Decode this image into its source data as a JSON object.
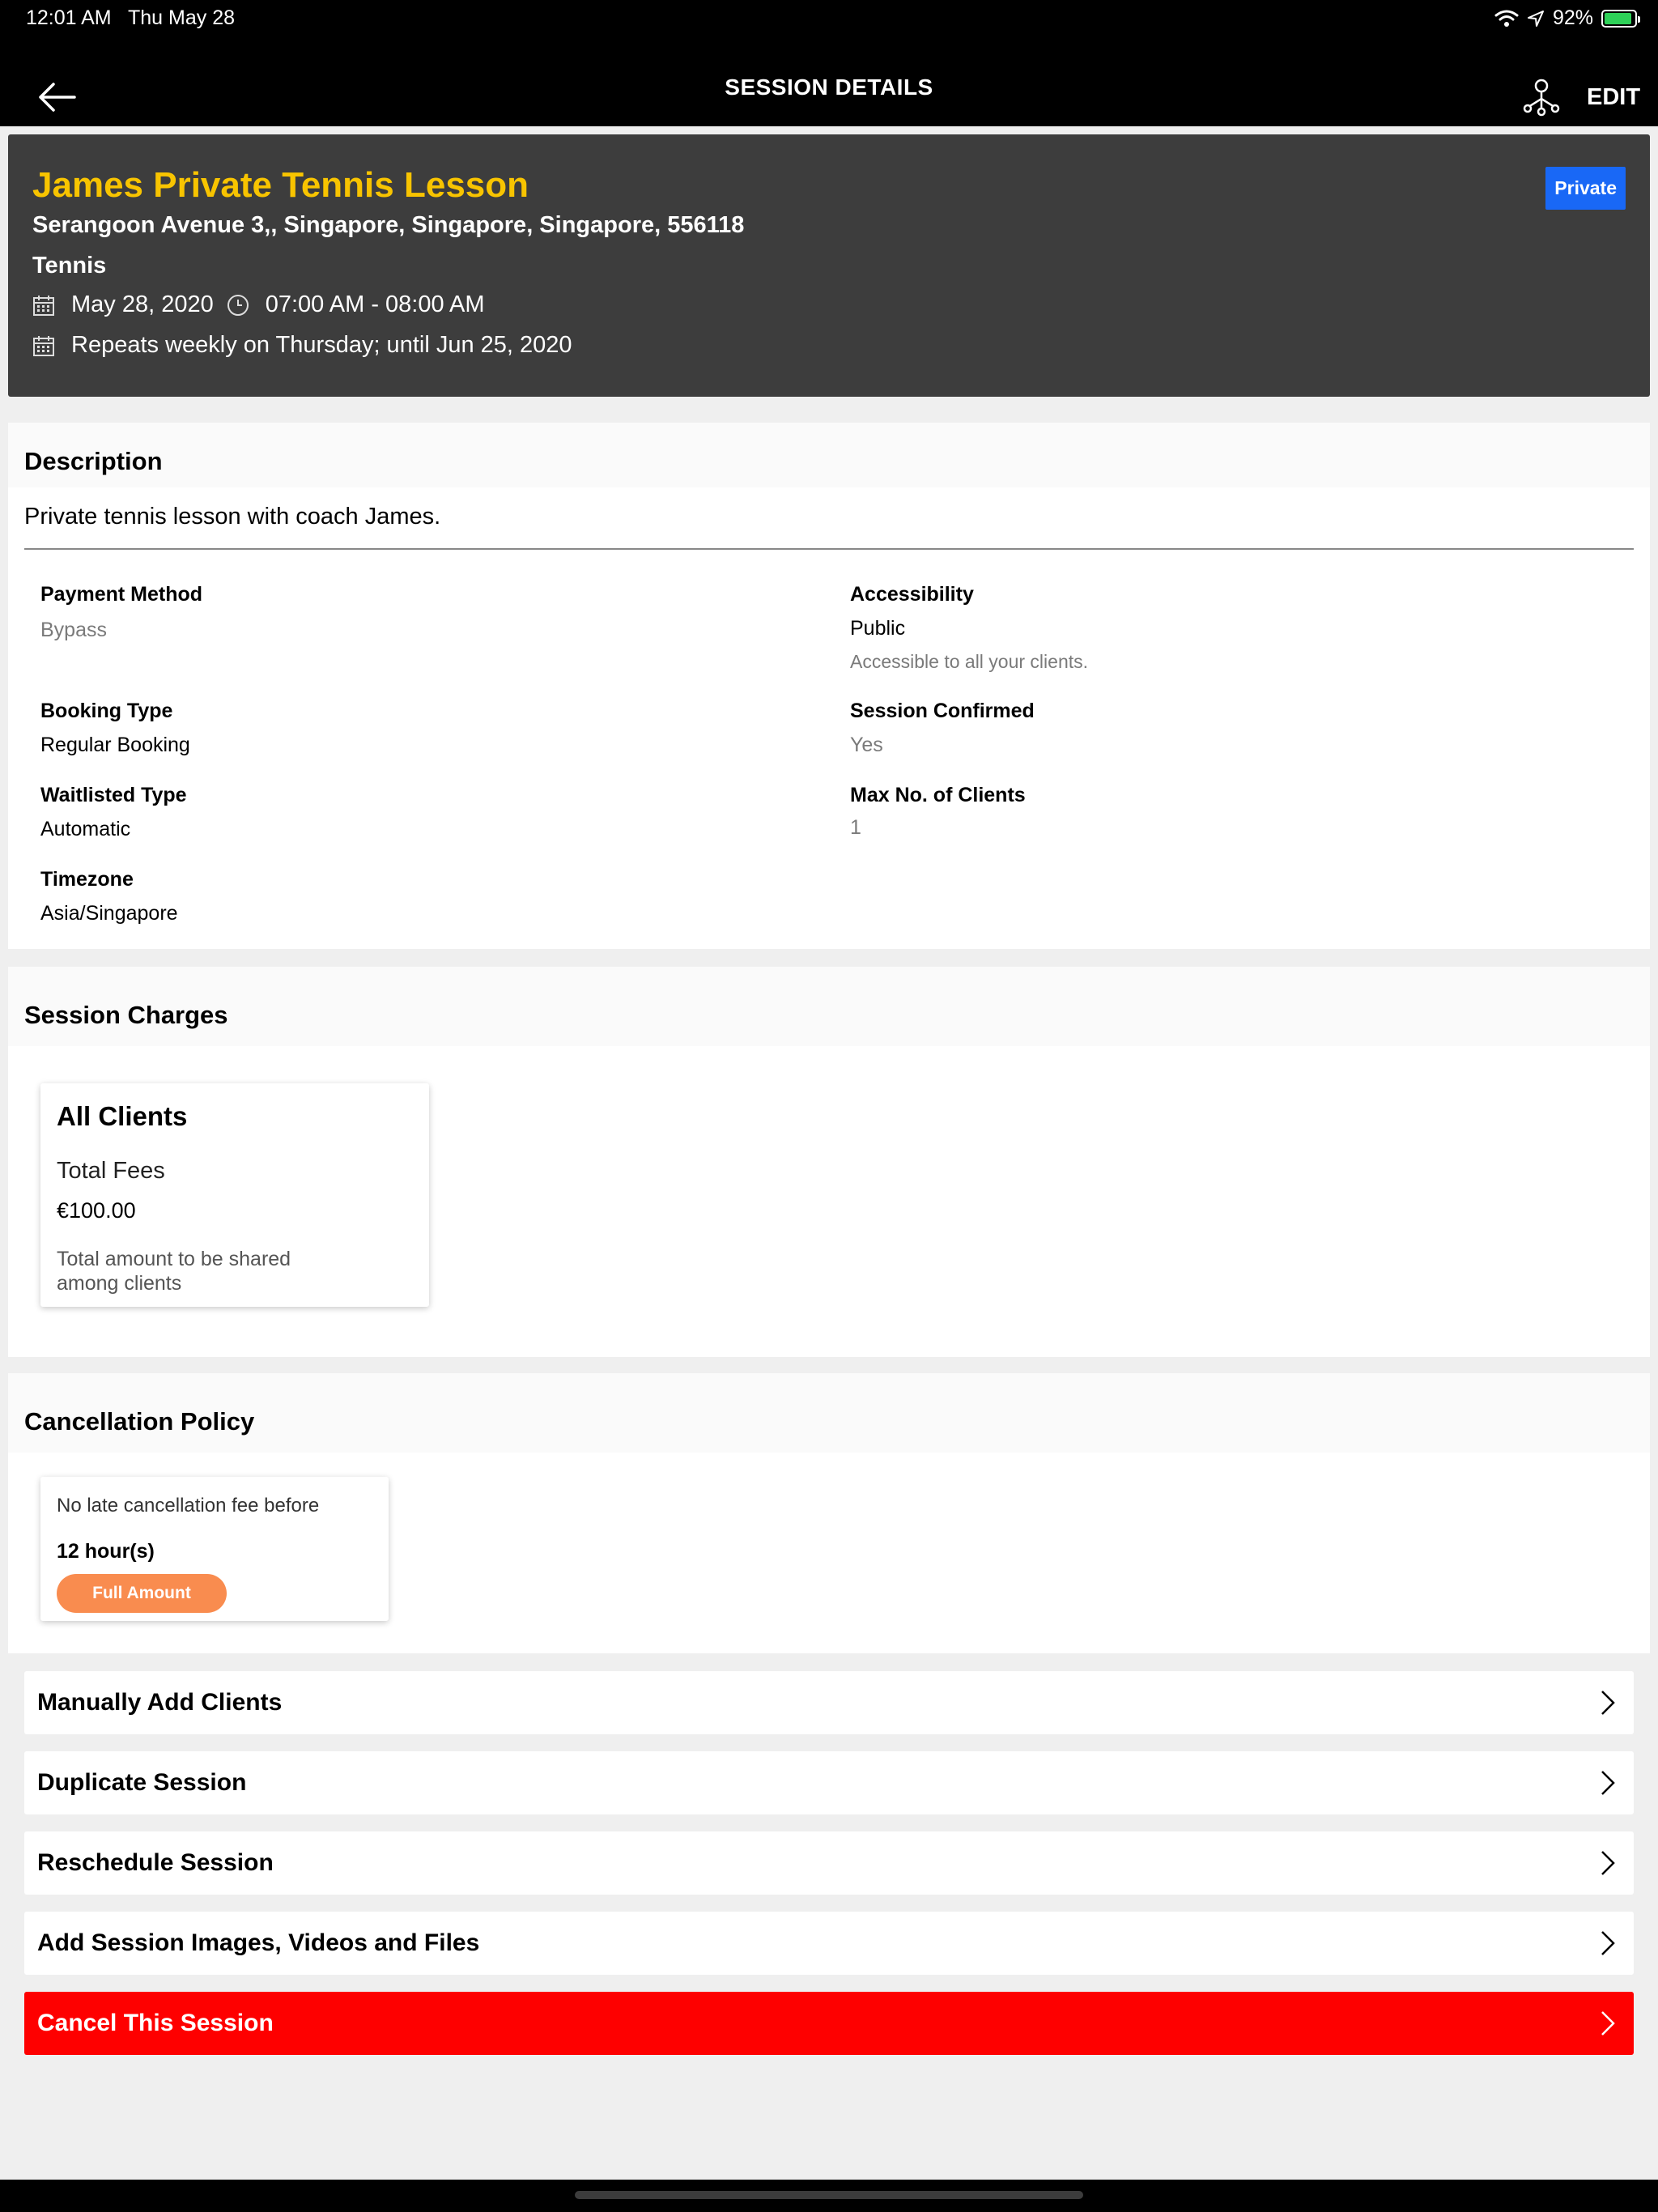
{
  "status": {
    "time": "12:01 AM",
    "date": "Thu May 28",
    "battery": "92%",
    "battery_level": 0.92,
    "icons": [
      "wifi-icon",
      "location-icon",
      "battery-icon"
    ]
  },
  "nav": {
    "title": "SESSION DETAILS",
    "edit_label": "EDIT",
    "icons": [
      "back-arrow-icon",
      "share-network-icon"
    ]
  },
  "session": {
    "title": "James Private Tennis Lesson",
    "address": "Serangoon Avenue 3,, Singapore, Singapore, Singapore, 556118",
    "sport": "Tennis",
    "date": "May 28, 2020",
    "time_range": "07:00 AM - 08:00 AM",
    "repeat": "Repeats weekly on Thursday; until Jun 25, 2020",
    "badge": "Private",
    "title_color": "#f8c400",
    "badge_color": "#1968f6"
  },
  "description": {
    "heading": "Description",
    "text": "Private tennis lesson with coach James.",
    "fields": {
      "payment_method": {
        "label": "Payment Method",
        "value": "Bypass"
      },
      "accessibility": {
        "label": "Accessibility",
        "value": "Public",
        "note": "Accessible to all your clients."
      },
      "booking_type": {
        "label": "Booking Type",
        "value": "Regular Booking"
      },
      "session_confirmed": {
        "label": "Session Confirmed",
        "value": "Yes"
      },
      "waitlisted_type": {
        "label": "Waitlisted Type",
        "value": "Automatic"
      },
      "max_clients": {
        "label": "Max No. of Clients",
        "value": "1"
      },
      "timezone": {
        "label": "Timezone",
        "value": "Asia/Singapore"
      }
    }
  },
  "charges": {
    "heading": "Session Charges",
    "card": {
      "title": "All Clients",
      "subtitle": "Total Fees",
      "amount": "€100.00",
      "note": "Total amount to be shared among clients"
    }
  },
  "cancellation": {
    "heading": "Cancellation Policy",
    "line": "No late cancellation fee before",
    "hours": "12 hour(s)",
    "pill": "Full Amount",
    "pill_color": "#f98c4f"
  },
  "actions": [
    {
      "label": "Manually Add Clients"
    },
    {
      "label": "Duplicate Session"
    },
    {
      "label": "Reschedule Session"
    },
    {
      "label": "Add Session Images, Videos and Files"
    },
    {
      "label": "Cancel This Session",
      "color": "#fe0000"
    }
  ]
}
